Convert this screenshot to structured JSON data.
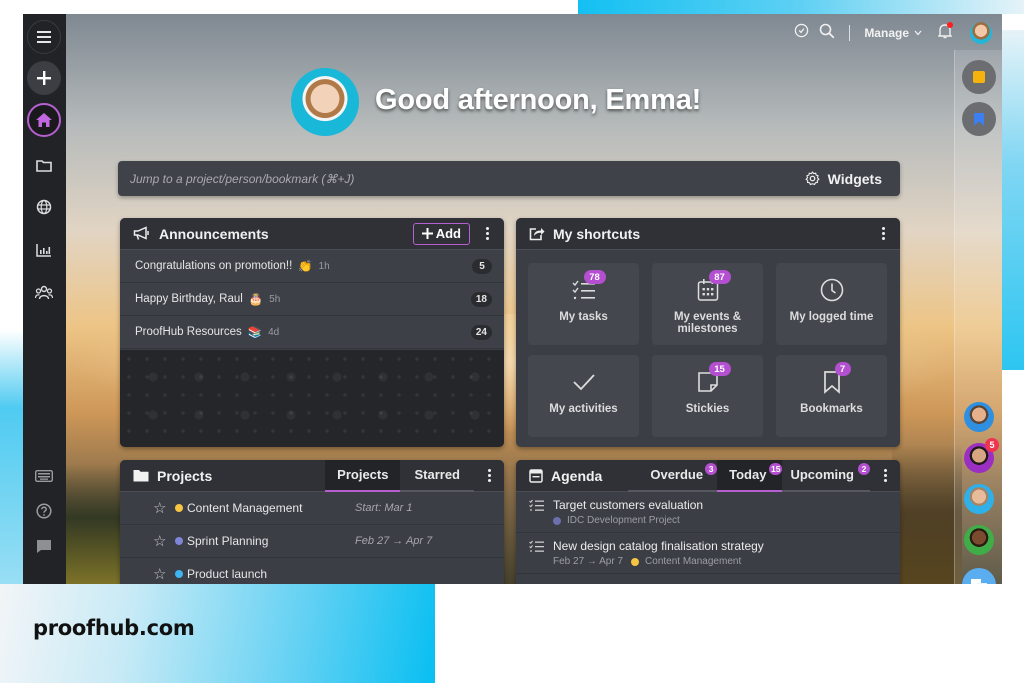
{
  "brand": {
    "site": "proofhub.com"
  },
  "sidebar": {
    "items": [
      {
        "icon": "hamburger-menu-icon"
      },
      {
        "icon": "plus-icon"
      },
      {
        "icon": "home-icon",
        "active": true
      },
      {
        "icon": "folder-icon"
      },
      {
        "icon": "globe-icon"
      },
      {
        "icon": "reports-chart-icon"
      },
      {
        "icon": "people-icon"
      },
      {
        "icon": "keyboard-icon"
      },
      {
        "icon": "help-icon"
      },
      {
        "icon": "chat-bubble-icon"
      }
    ],
    "active_color": "#b55fd0"
  },
  "topbar": {
    "manage_label": "Manage",
    "notification_dot": true
  },
  "greeting": {
    "text": "Good afternoon, Emma!"
  },
  "jumpbar": {
    "placeholder": "Jump to a project/person/bookmark (⌘+J)",
    "widgets_label": "Widgets"
  },
  "announcements": {
    "title": "Announcements",
    "add_label": "Add",
    "items": [
      {
        "text": "Congratulations on promotion!!",
        "emoji": "👏",
        "age": "1h",
        "count": "5"
      },
      {
        "text": "Happy Birthday, Raul",
        "emoji": "🎂",
        "age": "5h",
        "count": "18"
      },
      {
        "text": "ProofHub Resources",
        "emoji": "📚",
        "age": "4d",
        "count": "24"
      }
    ]
  },
  "shortcuts": {
    "title": "My shortcuts",
    "items": [
      {
        "label": "My tasks",
        "badge": "78",
        "icon": "tasks-list-icon"
      },
      {
        "label": "My events & milestones",
        "badge": "87",
        "icon": "calendar-icon"
      },
      {
        "label": "My logged time",
        "badge": null,
        "icon": "clock-icon"
      },
      {
        "label": "My activities",
        "badge": null,
        "icon": "checkmark-icon"
      },
      {
        "label": "Stickies",
        "badge": "15",
        "icon": "sticky-note-icon"
      },
      {
        "label": "Bookmarks",
        "badge": "7",
        "icon": "bookmark-icon"
      }
    ],
    "badge_color": "#b34fd0"
  },
  "projects": {
    "title": "Projects",
    "tabs": [
      {
        "label": "Projects",
        "active": true
      },
      {
        "label": "Starred",
        "active": false
      }
    ],
    "items": [
      {
        "name": "Content Management",
        "color": "#f6c543",
        "date": "Start: Mar 1"
      },
      {
        "name": "Sprint Planning",
        "color": "#7f86d8",
        "date": "Feb 27 → Apr 7"
      },
      {
        "name": "Product launch",
        "color": "#3fb4f0",
        "date": ""
      }
    ]
  },
  "agenda": {
    "title": "Agenda",
    "tabs": [
      {
        "label": "Overdue",
        "badge": "3",
        "active": false
      },
      {
        "label": "Today",
        "badge": "15",
        "active": true
      },
      {
        "label": "Upcoming",
        "badge": "2",
        "active": false
      }
    ],
    "items": [
      {
        "title": "Target customers evaluation",
        "date": "",
        "project": "IDC Development Project",
        "project_color": "#6b6fae"
      },
      {
        "title": "New design catalog finalisation strategy",
        "date": "Feb 27 → Apr 7",
        "project": "Content Management",
        "project_color": "#f6c543"
      }
    ]
  },
  "right_rail": {
    "items": [
      {
        "icon": "sticky-note-icon"
      },
      {
        "icon": "bookmark-icon"
      }
    ],
    "people": [
      {
        "name": "person-1",
        "badge": null
      },
      {
        "name": "person-2",
        "badge": "5"
      },
      {
        "name": "person-3",
        "badge": null
      },
      {
        "name": "person-4",
        "badge": null
      }
    ]
  }
}
